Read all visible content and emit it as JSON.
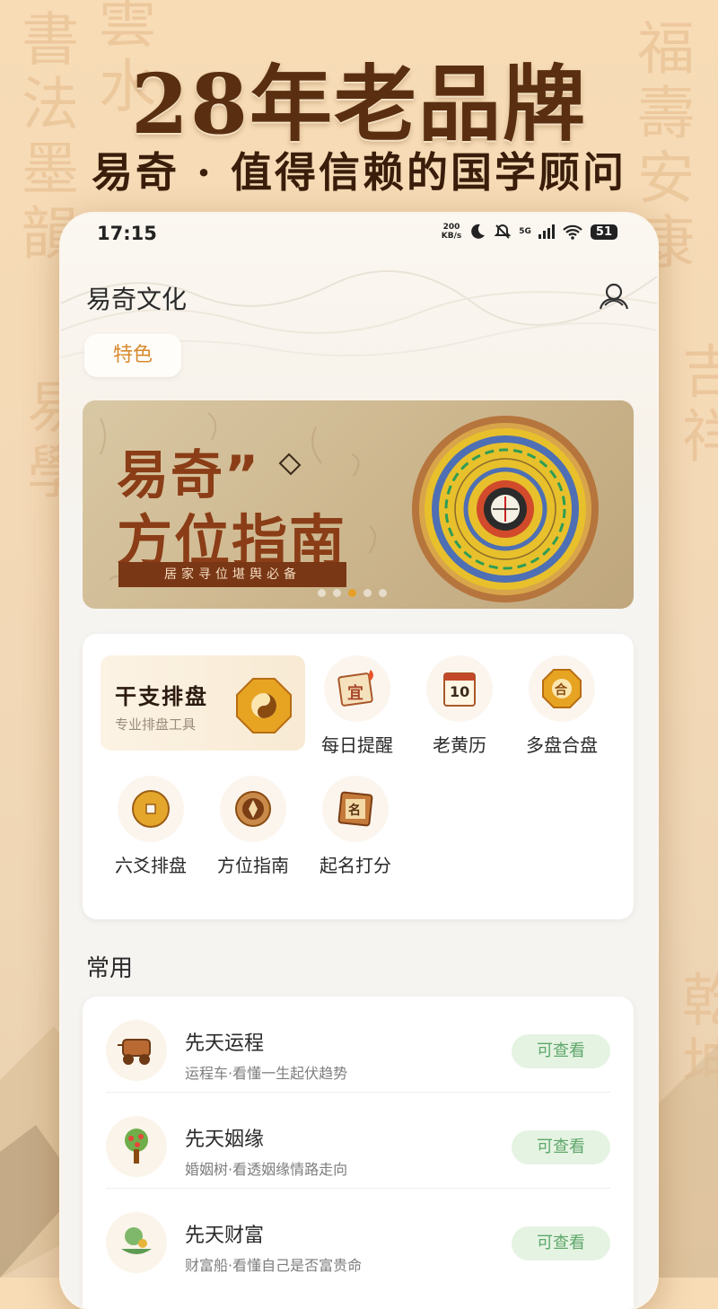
{
  "promo": {
    "headline": "28年老品牌",
    "subheadline": "易奇 · 值得信赖的国学顾问"
  },
  "status_bar": {
    "time": "17:15",
    "net_speed_value": "200",
    "net_speed_unit": "KB/s",
    "network": "5G",
    "battery": "51"
  },
  "header": {
    "app_title": "易奇文化",
    "tab_label": "特色"
  },
  "banner": {
    "title_line1": "易奇”",
    "title_line2": "方位指南",
    "tagline": "居家寻位堪舆必备",
    "page_count": 5,
    "active_index": 2
  },
  "tools": {
    "featured": {
      "name": "干支排盘",
      "desc": "专业排盘工具",
      "icon": "bagua-icon"
    },
    "items": [
      {
        "label": "每日提醒",
        "icon": "calendar-yi-icon"
      },
      {
        "label": "老黄历",
        "icon": "almanac-icon"
      },
      {
        "label": "多盘合盘",
        "icon": "he-octagon-icon"
      },
      {
        "label": "六爻排盘",
        "icon": "coin-icon"
      },
      {
        "label": "方位指南",
        "icon": "compass-icon"
      },
      {
        "label": "起名打分",
        "icon": "name-seal-icon"
      }
    ]
  },
  "common": {
    "section_title": "常用",
    "items": [
      {
        "title": "先天运程",
        "desc": "运程车·看懂一生起伏趋势",
        "action": "可查看",
        "icon": "cart-icon"
      },
      {
        "title": "先天姻缘",
        "desc": "婚姻树·看透姻缘情路走向",
        "action": "可查看",
        "icon": "tree-icon"
      },
      {
        "title": "先天财富",
        "desc": "财富船·看懂自己是否富贵命",
        "action": "可查看",
        "icon": "fortune-boat-icon"
      }
    ]
  },
  "almanac_icon_text": {
    "day": "10",
    "yi_char": "宜",
    "he_char": "合",
    "ming_char": "名"
  },
  "colors": {
    "brand_brown": "#8a3d16",
    "accent_orange": "#d68a2e",
    "action_green_bg": "#e5f3e2",
    "action_green_text": "#5ea76a"
  }
}
